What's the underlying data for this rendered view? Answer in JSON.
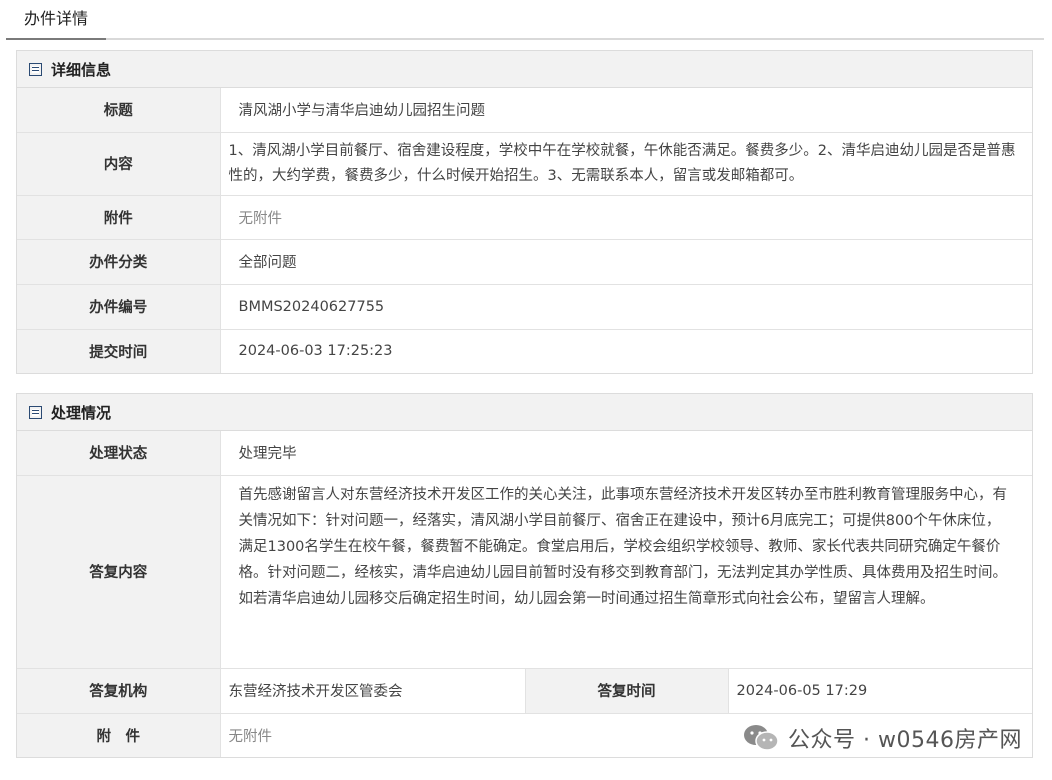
{
  "tab": {
    "label": "办件详情"
  },
  "detail": {
    "title": "详细信息",
    "rows": [
      {
        "label": "标题",
        "value": "清风湖小学与清华启迪幼儿园招生问题"
      },
      {
        "label": "内容",
        "value": "1、清风湖小学目前餐厅、宿舍建设程度，学校中午在学校就餐，午休能否满足。餐费多少。2、清华启迪幼儿园是否是普惠性的，大约学费，餐费多少，什么时候开始招生。3、无需联系本人，留言或发邮箱都可。"
      },
      {
        "label": "附件",
        "value": "无附件"
      },
      {
        "label": "办件分类",
        "value": "全部问题"
      },
      {
        "label": "办件编号",
        "value": "BMMS20240627755"
      },
      {
        "label": "提交时间",
        "value": "2024-06-03 17:25:23"
      }
    ]
  },
  "process": {
    "title": "处理情况",
    "status_label": "处理状态",
    "status_value": "处理完毕",
    "reply_label": "答复内容",
    "reply_value": "首先感谢留言人对东营经济技术开发区工作的关心关注，此事项东营经济技术开发区转办至市胜利教育管理服务中心，有关情况如下：针对问题一，经落实，清风湖小学目前餐厅、宿舍正在建设中，预计6月底完工；可提供800个午休床位，满足1300名学生在校午餐，餐费暂不能确定。食堂启用后，学校会组织学校领导、教师、家长代表共同研究确定午餐价格。针对问题二，经核实，清华启迪幼儿园目前暂时没有移交到教育部门，无法判定其办学性质、具体费用及招生时间。如若清华启迪幼儿园移交后确定招生时间，幼儿园会第一时间通过招生简章形式向社会公布，望留言人理解。",
    "org_label": "答复机构",
    "org_value": "东营经济技术开发区管委会",
    "time_label": "答复时间",
    "time_value": "2024-06-05 17:29",
    "attach_label": "附　件",
    "attach_value": "无附件"
  },
  "watermark": {
    "text": "公众号 · w0546房产网",
    "icon": "wechat-icon"
  }
}
